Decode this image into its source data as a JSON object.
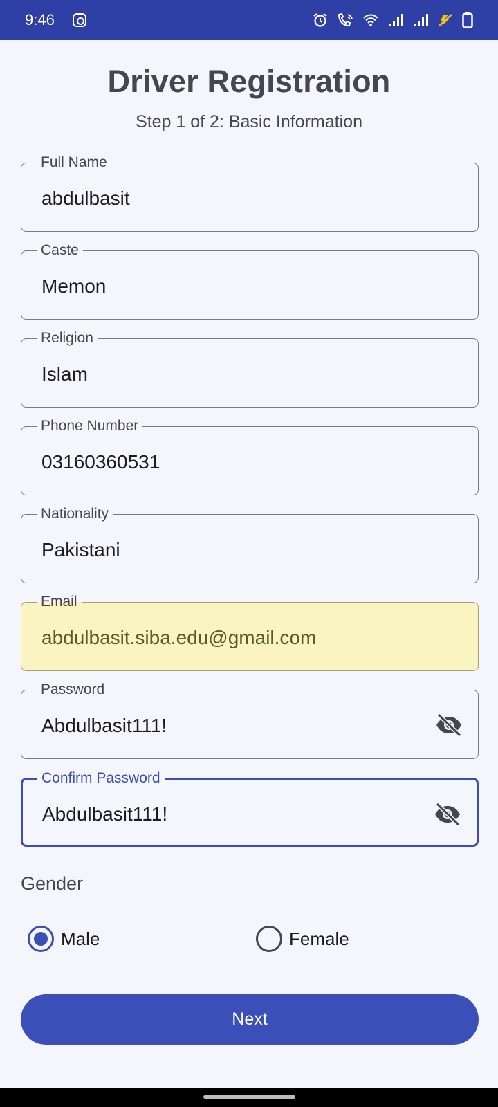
{
  "status_bar": {
    "time": "9:46",
    "icons": [
      "instagram-icon",
      "alarm-icon",
      "wifi-call-icon",
      "wifi-icon",
      "signal-icon",
      "signal-icon",
      "battery-saver-icon",
      "battery-icon"
    ]
  },
  "header": {
    "title": "Driver Registration",
    "subtitle": "Step 1 of 2: Basic Information"
  },
  "form": {
    "fields": [
      {
        "label": "Full Name",
        "value": "abdulbasit"
      },
      {
        "label": "Caste",
        "value": "Memon"
      },
      {
        "label": "Religion",
        "value": "Islam"
      },
      {
        "label": "Phone Number",
        "value": "03160360531"
      },
      {
        "label": "Nationality",
        "value": "Pakistani"
      },
      {
        "label": "Email",
        "value": "abdulbasit.siba.edu@gmail.com"
      },
      {
        "label": "Password",
        "value": "Abdulbasit111!"
      },
      {
        "label": "Confirm Password",
        "value": "Abdulbasit111!"
      }
    ],
    "gender": {
      "label": "Gender",
      "options": [
        {
          "label": "Male",
          "selected": true
        },
        {
          "label": "Female",
          "selected": false
        }
      ]
    },
    "next_label": "Next"
  },
  "colors": {
    "status_bar": "#2e3fa6",
    "primary": "#3a50b8",
    "autofill_bg": "#faf4c0",
    "background": "#f5f6fb"
  }
}
